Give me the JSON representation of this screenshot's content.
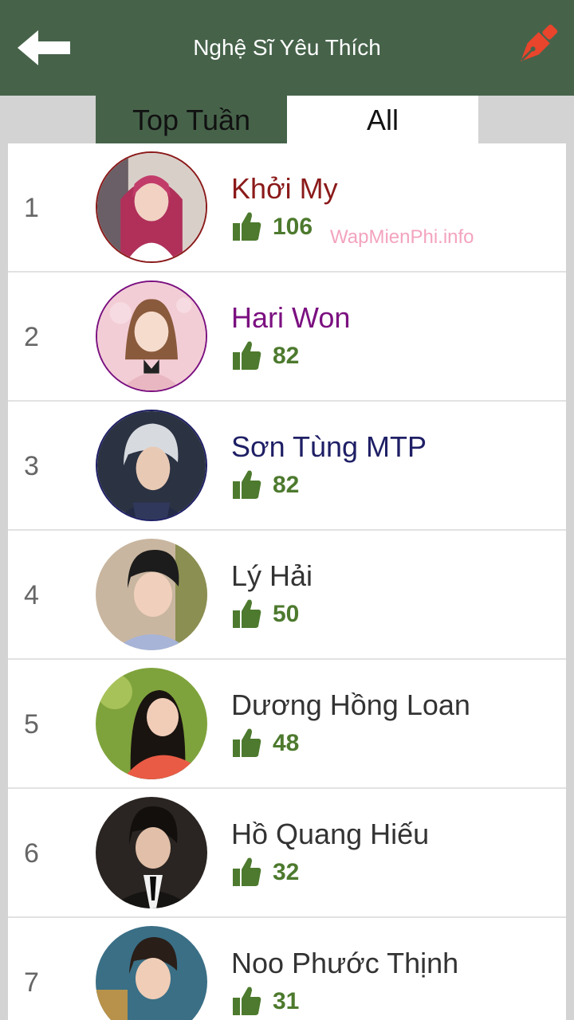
{
  "header": {
    "title": "Nghệ Sĩ Yêu Thích",
    "back_icon": "back-arrow-icon",
    "edit_icon": "pen-icon",
    "bg_color": "#46634a"
  },
  "tabs": [
    {
      "label": "Top Tuần",
      "active": false
    },
    {
      "label": "All",
      "active": true
    }
  ],
  "watermark": "WapMienPhi.info",
  "artists": [
    {
      "rank": "1",
      "name": "Khởi My",
      "likes": "106",
      "name_color": "#8b1a1a",
      "ring_color": "#8b1a1a"
    },
    {
      "rank": "2",
      "name": "Hari Won",
      "likes": "82",
      "name_color": "#7b1080",
      "ring_color": "#7b1080"
    },
    {
      "rank": "3",
      "name": "Sơn Tùng MTP",
      "likes": "82",
      "name_color": "#1f1f66",
      "ring_color": "#1f1f66"
    },
    {
      "rank": "4",
      "name": "Lý Hải",
      "likes": "50",
      "name_color": "#333333",
      "ring_color": ""
    },
    {
      "rank": "5",
      "name": "Dương Hồng Loan",
      "likes": "48",
      "name_color": "#333333",
      "ring_color": ""
    },
    {
      "rank": "6",
      "name": "Hồ Quang Hiếu",
      "likes": "32",
      "name_color": "#333333",
      "ring_color": ""
    },
    {
      "rank": "7",
      "name": "Noo Phước Thịnh",
      "likes": "31",
      "name_color": "#333333",
      "ring_color": ""
    }
  ],
  "like_icon": "thumbs-up-icon",
  "like_color": "#4d7a2e"
}
